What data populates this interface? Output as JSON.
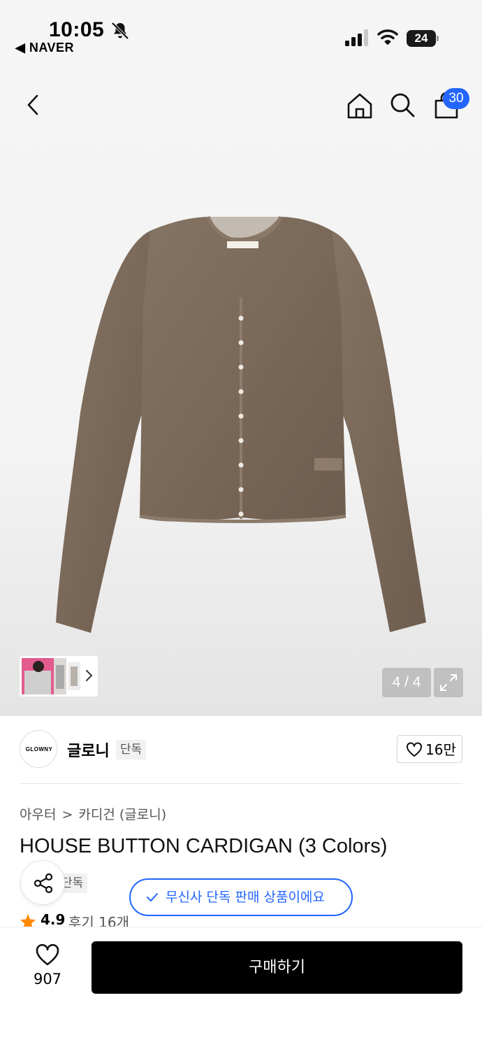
{
  "status_bar": {
    "time": "10:05",
    "back_app": "◀ NAVER",
    "battery": "24"
  },
  "header": {
    "cart_count": "30"
  },
  "gallery": {
    "counter": "4 / 4"
  },
  "brand": {
    "logo_text": "GLOWNY",
    "name": "글로니",
    "tag": "단독",
    "likes": "16만"
  },
  "breadcrumb": {
    "category": "아우터",
    "separator": ">",
    "subcategory": "카디건 (글로니)"
  },
  "product": {
    "title": "HOUSE BUTTON CARDIGAN (3 Colors)",
    "exclusive_tag": "단독"
  },
  "musinsa_notice": "무신사 단독 판매 상품이에요",
  "rating": {
    "score": "4.9",
    "reviews": "후기 16개"
  },
  "bottom_bar": {
    "wish_count": "907",
    "buy_label": "구매하기"
  },
  "colors": {
    "accent": "#2265ff",
    "buy_button": "#000000",
    "star": "#ff8a00",
    "product": "#7a6858"
  },
  "icons": {
    "status": [
      "bell-off-icon",
      "signal-icon",
      "wifi-icon",
      "battery-icon"
    ],
    "header": [
      "back-arrow-icon",
      "home-icon",
      "search-icon",
      "shopping-bag-icon"
    ],
    "gallery": [
      "chevron-right-icon",
      "expand-icon"
    ],
    "actions": [
      "heart-icon",
      "share-icon",
      "check-icon",
      "star-icon"
    ]
  }
}
